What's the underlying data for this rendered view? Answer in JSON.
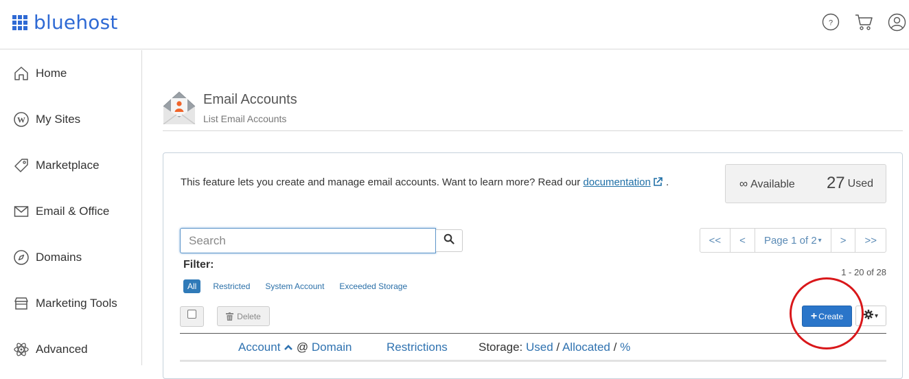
{
  "brand": {
    "name": "bluehost"
  },
  "header": {
    "icons": [
      "help-icon",
      "cart-icon",
      "account-icon"
    ]
  },
  "sidebar": {
    "items": [
      {
        "label": "Home",
        "icon": "home-icon"
      },
      {
        "label": "My Sites",
        "icon": "wordpress-icon"
      },
      {
        "label": "Marketplace",
        "icon": "tag-icon"
      },
      {
        "label": "Email & Office",
        "icon": "envelope-icon"
      },
      {
        "label": "Domains",
        "icon": "compass-icon"
      },
      {
        "label": "Marketing Tools",
        "icon": "store-icon"
      },
      {
        "label": "Advanced",
        "icon": "atom-icon"
      }
    ]
  },
  "page": {
    "title": "Email Accounts",
    "subtitle": "List Email Accounts"
  },
  "panel": {
    "description": "This feature lets you create and manage email accounts. Want to learn more? Read our ",
    "doc_link": "documentation",
    "description_end": ".",
    "stats": {
      "available_symbol": "∞",
      "available_label": "Available",
      "used_count": "27",
      "used_label": "Used"
    }
  },
  "search": {
    "placeholder": "Search",
    "value": ""
  },
  "filter": {
    "label": "Filter:",
    "options": [
      "All",
      "Restricted",
      "System Account",
      "Exceeded Storage"
    ],
    "active": "All"
  },
  "pager": {
    "first": "<<",
    "prev": "<",
    "page_label": "Page 1 of 2",
    "next": ">",
    "last": ">>"
  },
  "range": "1 - 20 of 28",
  "actions": {
    "delete_label": "Delete",
    "create_label": "Create"
  },
  "table": {
    "account": "Account",
    "at": "@",
    "domain": "Domain",
    "restrictions": "Restrictions",
    "storage": "Storage:",
    "used": "Used",
    "sep1": "/",
    "allocated": "Allocated",
    "sep2": "/",
    "percent": "%"
  },
  "colors": {
    "brand": "#2f6ad4",
    "primary_button": "#2a75c9",
    "annotation_ring": "#d9171a",
    "link": "#2f72b0"
  }
}
